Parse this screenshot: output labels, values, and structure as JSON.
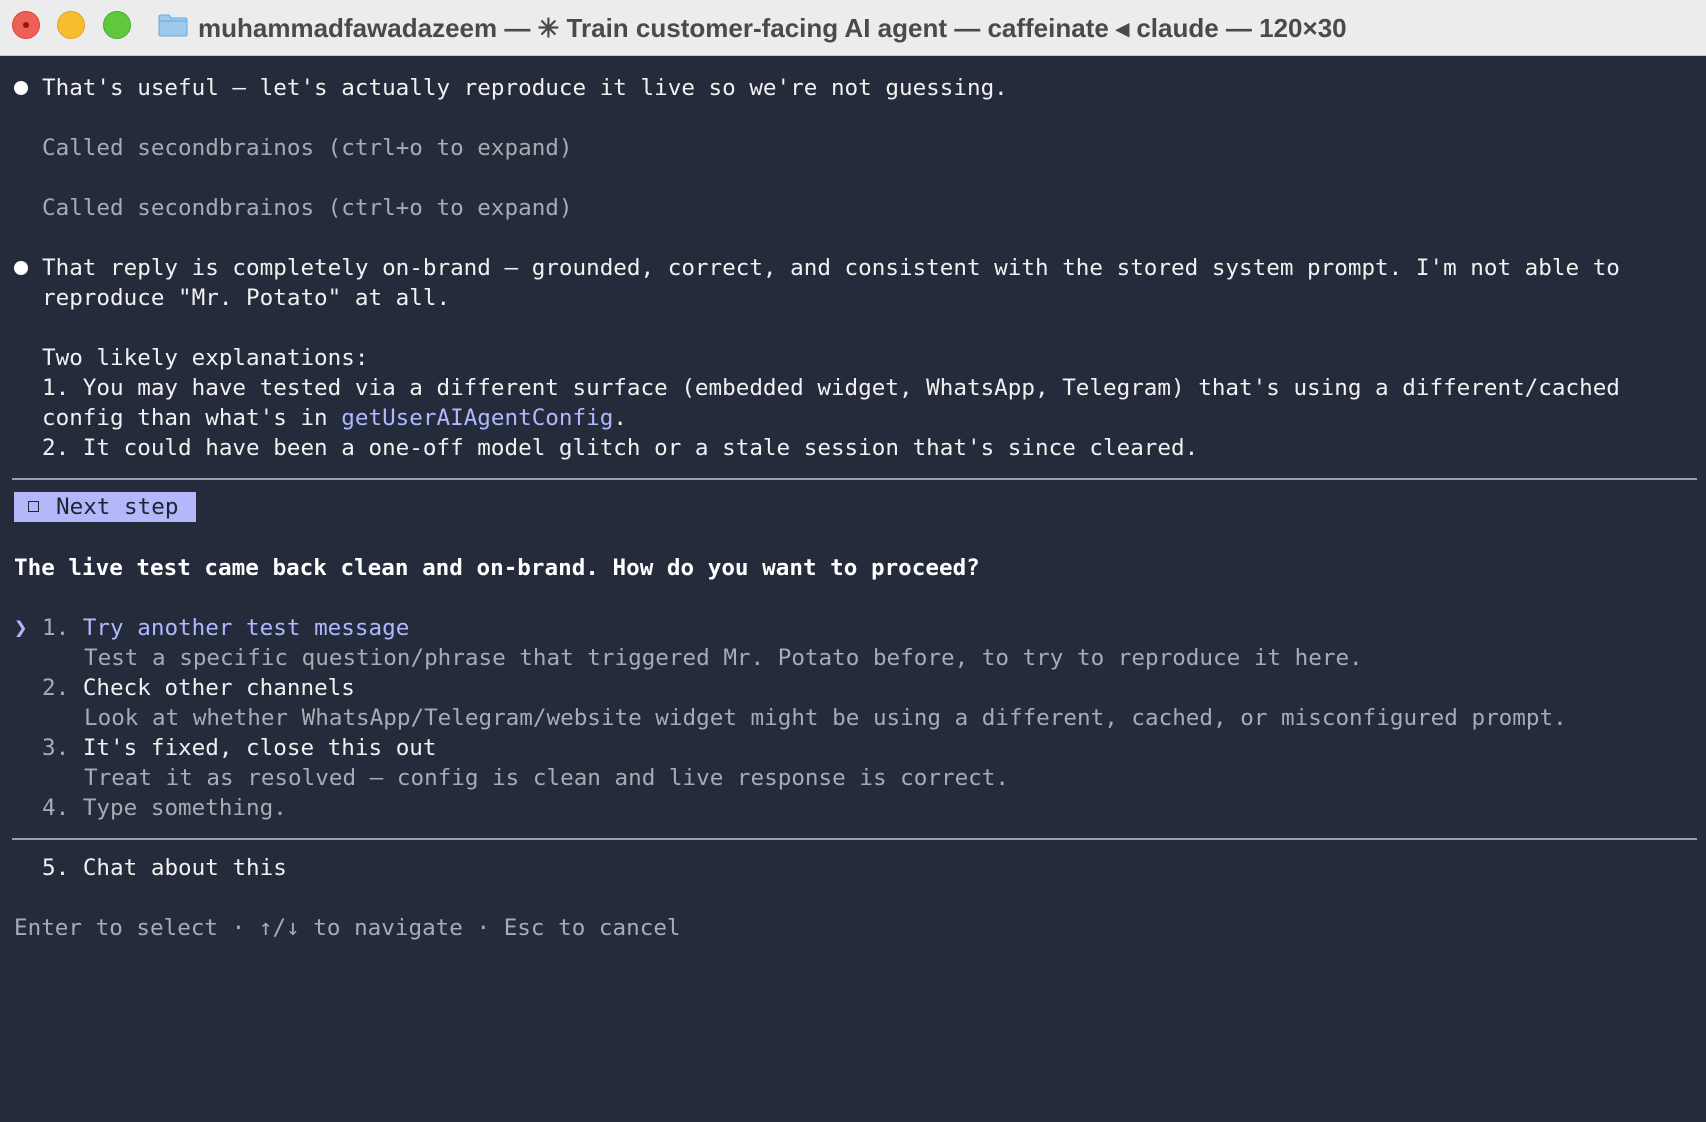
{
  "window": {
    "title": "muhammadfawadazeem — ✳ Train customer-facing AI agent — caffeinate ◂ claude — 120×30"
  },
  "messages": [
    {
      "text": "That's useful — let's actually reproduce it live so we're not guessing."
    }
  ],
  "tool_calls": [
    "Called secondbrainos (ctrl+o to expand)",
    "Called secondbrainos (ctrl+o to expand)"
  ],
  "reply": {
    "line1": "That reply is completely on-brand — grounded, correct, and consistent with the stored system prompt. I'm not able to",
    "line2": "reproduce \"Mr. Potato\" at all.",
    "explanations_heading": "Two likely explanations:",
    "exp1_line1": "1. You may have tested via a different surface (embedded widget, WhatsApp, Telegram) that's using a different/cached",
    "exp1_line2_prefix": "config than what's in ",
    "exp1_code": "getUserAIAgentConfig",
    "exp1_line2_suffix": ".",
    "exp2": "2. It could have been a one-off model glitch or a stale session that's since cleared."
  },
  "prompt": {
    "badge_label": "Next step",
    "question": "The live test came back clean and on-brand. How do you want to proceed?",
    "pointer": "❯",
    "options": [
      {
        "num": "1.",
        "label": "Try another test message",
        "desc": "Test a specific question/phrase that triggered Mr. Potato before, to try to reproduce it here."
      },
      {
        "num": "2.",
        "label": "Check other channels",
        "desc": "Look at whether WhatsApp/Telegram/website widget might be using a different, cached, or misconfigured prompt."
      },
      {
        "num": "3.",
        "label": "It's fixed, close this out",
        "desc": "Treat it as resolved — config is clean and live response is correct."
      },
      {
        "num": "4.",
        "label": "Type something."
      }
    ],
    "extra_option": {
      "num": "5.",
      "label": "Chat about this"
    },
    "footer": "Enter to select · ↑/↓ to navigate · Esc to cancel"
  },
  "colors": {
    "background": "#242b3a",
    "accent": "#b2b7ff",
    "badge_bg": "#b5b7fb"
  }
}
